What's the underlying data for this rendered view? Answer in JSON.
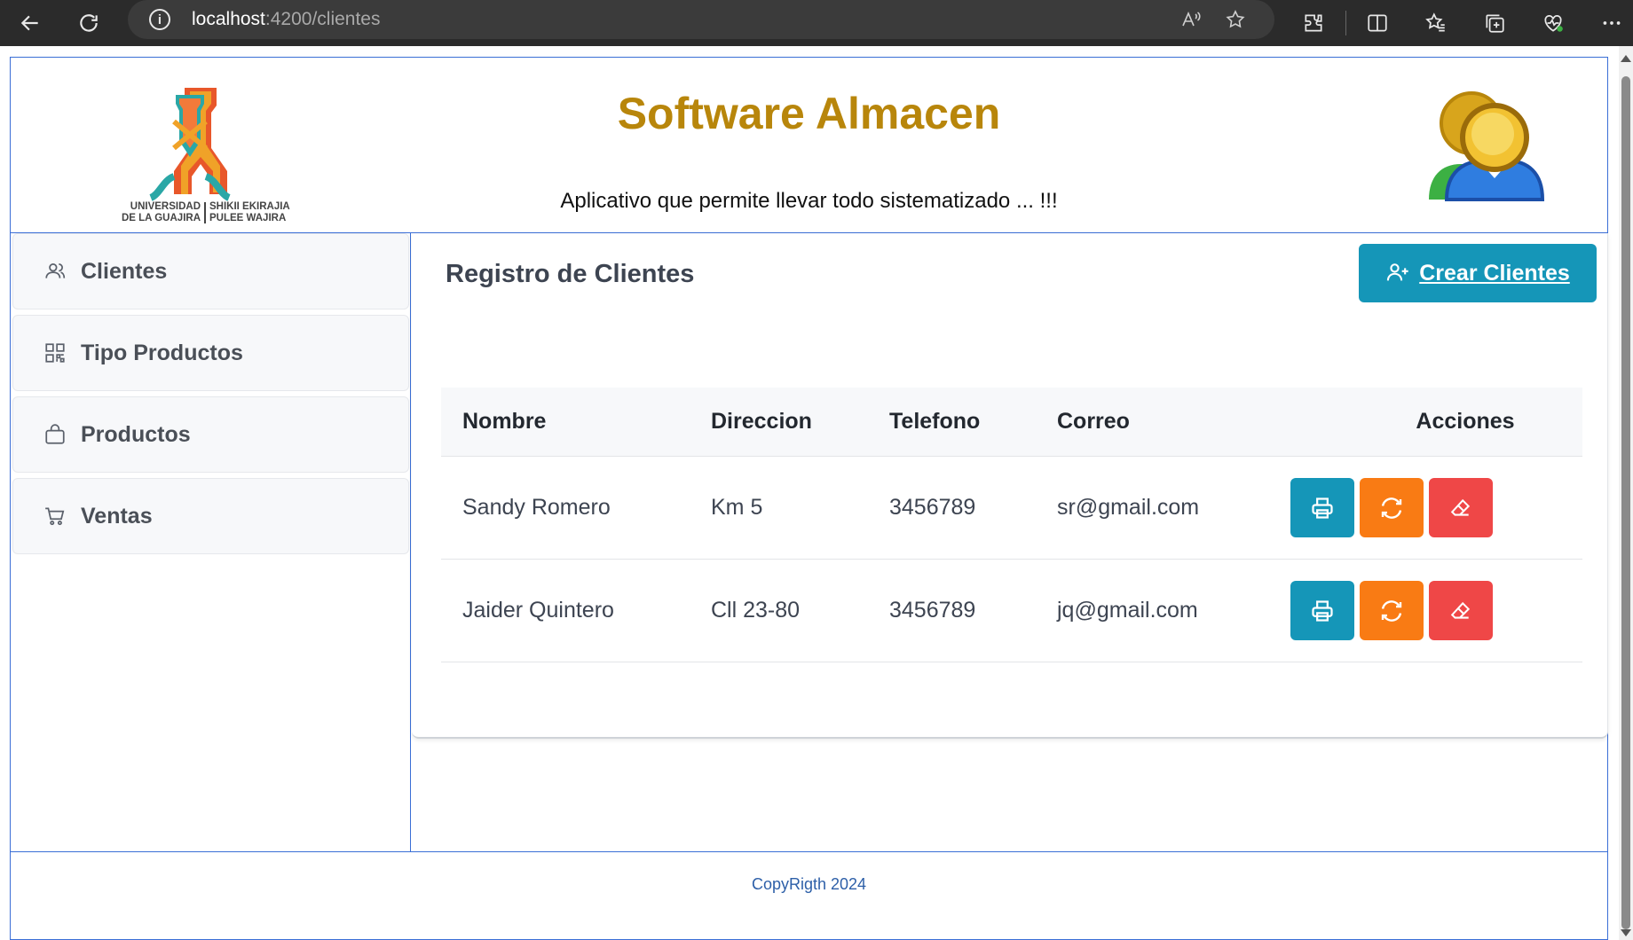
{
  "browser": {
    "url_host": "localhost",
    "url_path": ":4200/clientes",
    "icons": [
      "back-icon",
      "refresh-icon",
      "info-icon",
      "read-aloud-icon",
      "favorite-star-icon",
      "extensions-icon",
      "split-screen-icon",
      "favorites-icon",
      "collections-icon",
      "browser-essentials-icon",
      "more-icon"
    ]
  },
  "header": {
    "title": "Software Almacen",
    "subtitle": "Aplicativo que permite llevar todo sistematizado ... !!!",
    "logo_text": {
      "left_line1": "UNIVERSIDAD",
      "left_line2": "DE LA GUAJIRA",
      "right_line1": "SHIKII EKIRAJIA",
      "right_line2": "PULEE  WAJIRA"
    }
  },
  "sidebar": {
    "items": [
      {
        "label": "Clientes",
        "icon": "users-icon"
      },
      {
        "label": "Tipo Productos",
        "icon": "qr-grid-icon"
      },
      {
        "label": "Productos",
        "icon": "shopping-bag-icon"
      },
      {
        "label": "Ventas",
        "icon": "cart-icon"
      }
    ]
  },
  "main": {
    "title": "Registro de Clientes",
    "create_label": "Crear Clientes",
    "table": {
      "headers": [
        "Nombre",
        "Direccion",
        "Telefono",
        "Correo",
        "Acciones"
      ],
      "rows": [
        {
          "nombre": "Sandy Romero",
          "direccion": "Km 5",
          "telefono": "3456789",
          "correo": "sr@gmail.com"
        },
        {
          "nombre": "Jaider Quintero",
          "direccion": "Cll 23-80",
          "telefono": "3456789",
          "correo": "jq@gmail.com"
        }
      ]
    }
  },
  "footer": {
    "copyright": "CopyRigth 2024"
  },
  "colors": {
    "brand_gold": "#b8860b",
    "frame_blue": "#3a6ed6",
    "primary": "#1596b8",
    "warning": "#f97b14",
    "danger": "#ef4747"
  }
}
